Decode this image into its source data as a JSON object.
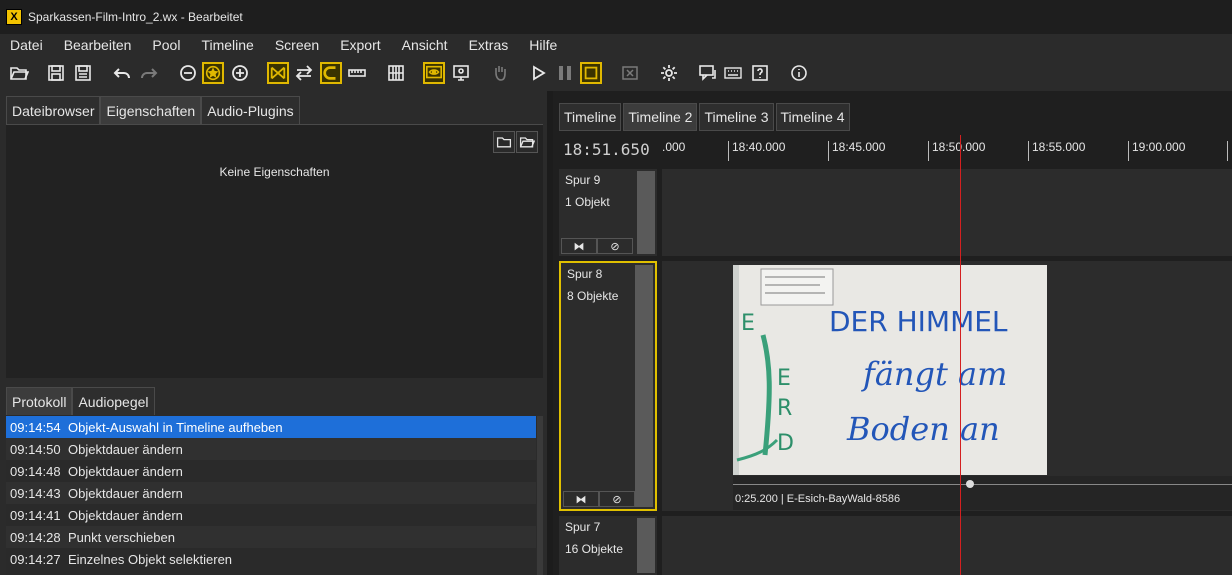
{
  "window": {
    "title": "Sparkassen-Film-Intro_2.wx - Bearbeitet",
    "app_icon_glyph": "X"
  },
  "menu": [
    "Datei",
    "Bearbeiten",
    "Pool",
    "Timeline",
    "Screen",
    "Export",
    "Ansicht",
    "Extras",
    "Hilfe"
  ],
  "toolbar": {
    "icons": [
      "open-folder-icon",
      "save-icon",
      "save-all-icon",
      "undo-icon",
      "redo-icon",
      "zoom-out-icon",
      "zoom-fit-icon",
      "zoom-in-icon",
      "crossfade-icon",
      "swap-icon",
      "magnet-icon",
      "ruler-icon",
      "grid-icon",
      "preview-eye-icon",
      "monitor-icon",
      "hand-icon",
      "play-icon",
      "pause-icon",
      "stop-icon",
      "close-box-icon",
      "settings-icon",
      "comment-icon",
      "keyboard-icon",
      "help-icon",
      "info-icon"
    ],
    "accent_color": "#e0b800"
  },
  "left": {
    "tabs": [
      "Dateibrowser",
      "Eigenschaften",
      "Audio-Plugins"
    ],
    "active_tab": "Eigenschaften",
    "empty_text": "Keine Eigenschaften",
    "log_tabs": [
      "Protokoll",
      "Audiopegel"
    ],
    "log": [
      {
        "time": "09:14:54",
        "text": "Objekt-Auswahl in Timeline aufheben"
      },
      {
        "time": "09:14:50",
        "text": "Objektdauer ändern"
      },
      {
        "time": "09:14:48",
        "text": "Objektdauer ändern"
      },
      {
        "time": "09:14:43",
        "text": "Objektdauer ändern"
      },
      {
        "time": "09:14:41",
        "text": "Objektdauer ändern"
      },
      {
        "time": "09:14:28",
        "text": "Punkt verschieben"
      },
      {
        "time": "09:14:27",
        "text": "Einzelnes Objekt selektieren"
      }
    ],
    "selection_color": "#1e6fd9"
  },
  "timeline": {
    "tabs": [
      "Timeline",
      "Timeline 2",
      "Timeline 3",
      "Timeline 4"
    ],
    "active_tab": "Timeline 2",
    "timecode": "18:51.650",
    "ruler": [
      ".000",
      "18:40.000",
      "18:45.000",
      "18:50.000",
      "18:55.000",
      "19:00.000"
    ],
    "tracks": [
      {
        "name": "Spur 9",
        "count": "1 Objekt"
      },
      {
        "name": "Spur 8",
        "count": "8 Objekte"
      },
      {
        "name": "Spur 7",
        "count": "16 Objekte"
      }
    ],
    "track_buttons": [
      "⧓",
      "⊘"
    ],
    "clip": {
      "label": "0:25.200 | E-Esich-BayWald-8586",
      "image_text": [
        "DER HIMMEL",
        "fängt am",
        "Boden an"
      ],
      "side_letters": [
        "E",
        "E",
        "R",
        "D"
      ]
    },
    "playhead_color": "#d42020",
    "selected_color": "#e0c000"
  }
}
